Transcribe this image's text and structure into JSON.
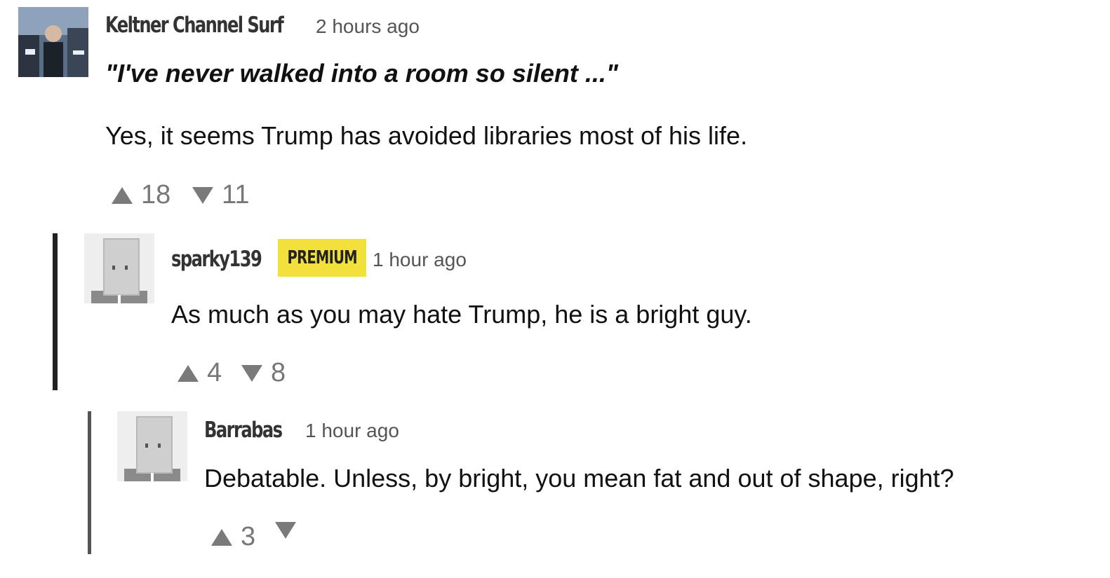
{
  "comments": [
    {
      "author": "Keltner Channel Surf",
      "time": "2 hours ago",
      "quote": "\"I've never walked into a room so silent ...\"",
      "text": "Yes, it seems Trump has avoided libraries most of his life.",
      "upvotes": "18",
      "downvotes": "11"
    },
    {
      "author": "sparky139",
      "badge": "PREMIUM",
      "time": "1 hour ago",
      "text": "As much as you may hate Trump, he is a bright guy.",
      "upvotes": "4",
      "downvotes": "8"
    },
    {
      "author": "Barrabas",
      "time": "1 hour ago",
      "text": "Debatable. Unless, by bright, you mean fat and out of shape, right?",
      "upvotes": "3",
      "downvotes": ""
    }
  ],
  "icons": {
    "upvote": "triangle-up-icon",
    "downvote": "triangle-down-icon"
  },
  "colors": {
    "premium_badge": "#f2e13b",
    "vote_grey": "#7a7a7a",
    "thread_bar": "#222222"
  }
}
